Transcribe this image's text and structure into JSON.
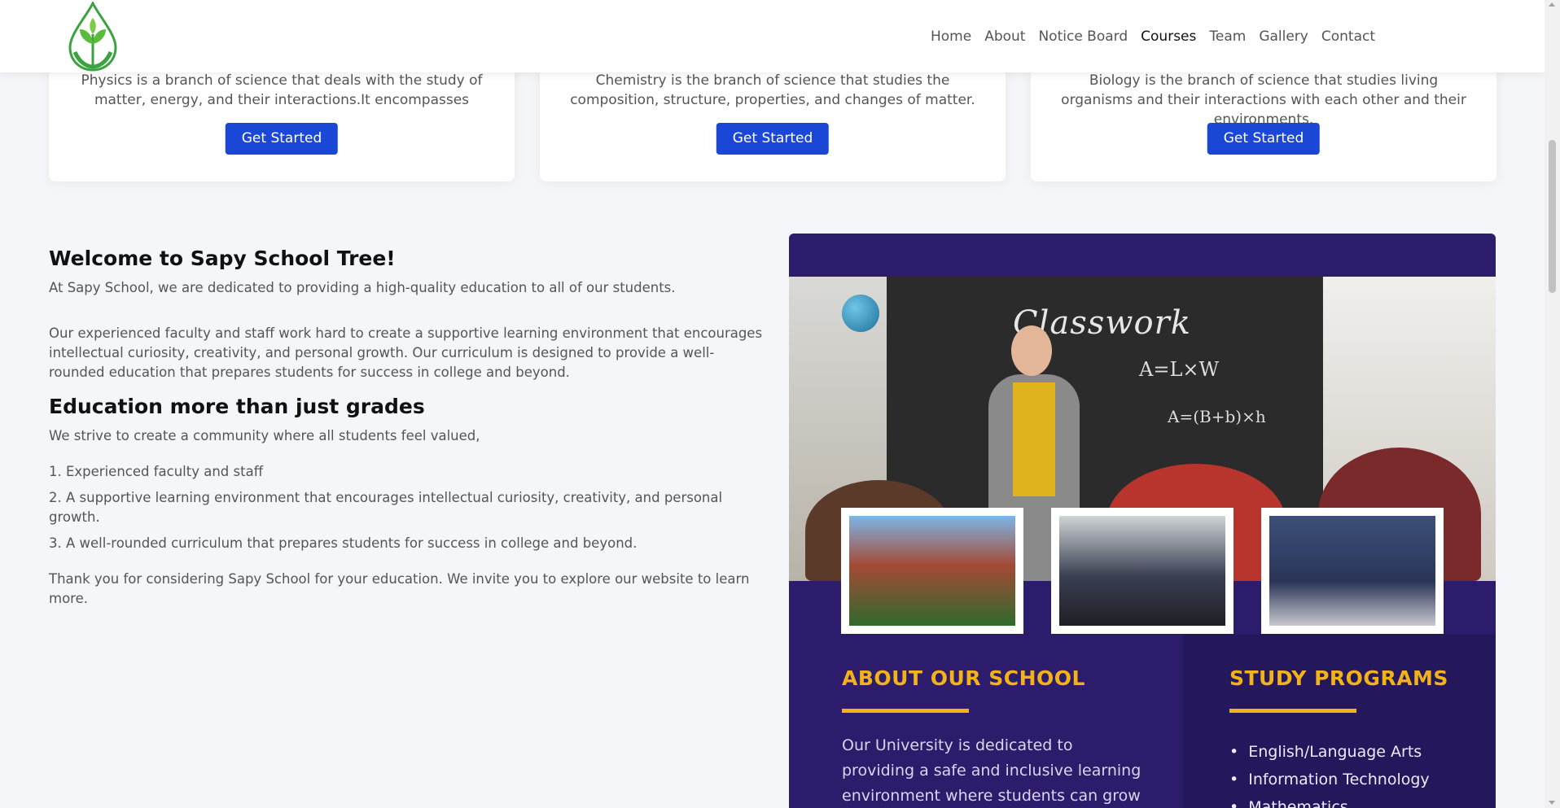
{
  "header": {
    "logo_icon": "leaf-drop-logo",
    "nav": [
      {
        "label": "Home",
        "active": false
      },
      {
        "label": "About",
        "active": false
      },
      {
        "label": "Notice Board",
        "active": false
      },
      {
        "label": "Courses",
        "active": true
      },
      {
        "label": "Team",
        "active": false
      },
      {
        "label": "Gallery",
        "active": false
      },
      {
        "label": "Contact",
        "active": false
      }
    ]
  },
  "courses": [
    {
      "description": "Physics is a branch of science that deals with the study of matter, energy, and their interactions.It encompasses",
      "button": "Get Started"
    },
    {
      "description": "Chemistry is the branch of science that studies the composition, structure, properties, and changes of matter.",
      "button": "Get Started"
    },
    {
      "description": "Biology is the branch of science that studies living organisms and their interactions with each other and their environments.",
      "button": "Get Started"
    }
  ],
  "welcome": {
    "title": "Welcome to Sapy School Tree!",
    "intro": "At Sapy School, we are dedicated to providing a high-quality education to all of our students.",
    "body": "Our experienced faculty and staff work hard to create a supportive learning environment that encourages intellectual curiosity, creativity, and personal growth. Our curriculum is designed to provide a well-rounded education that prepares students for success in college and beyond.",
    "subtitle": "Education more than just grades",
    "strive": "We strive to create a community where all students feel valued,",
    "points": [
      "1. Experienced faculty and staff",
      "2. A supportive learning environment that encourages intellectual curiosity, creativity, and personal growth.",
      "3. A well-rounded curriculum that prepares students for success in college and beyond."
    ],
    "closing": "Thank you for considering Sapy School for your education. We invite you to explore our website to learn more."
  },
  "promo": {
    "board_title": "Classwork",
    "about_title": "ABOUT OUR SCHOOL",
    "about_text": "Our University is dedicated to providing a safe and inclusive learning environment where students can grow",
    "programs_title": "STUDY PROGRAMS",
    "programs": [
      "English/Language Arts",
      "Information Technology",
      "Mathematics"
    ]
  },
  "colors": {
    "primary_button": "#1a47d6",
    "promo_purple": "#2d1b6b",
    "promo_accent": "#f2b318"
  }
}
